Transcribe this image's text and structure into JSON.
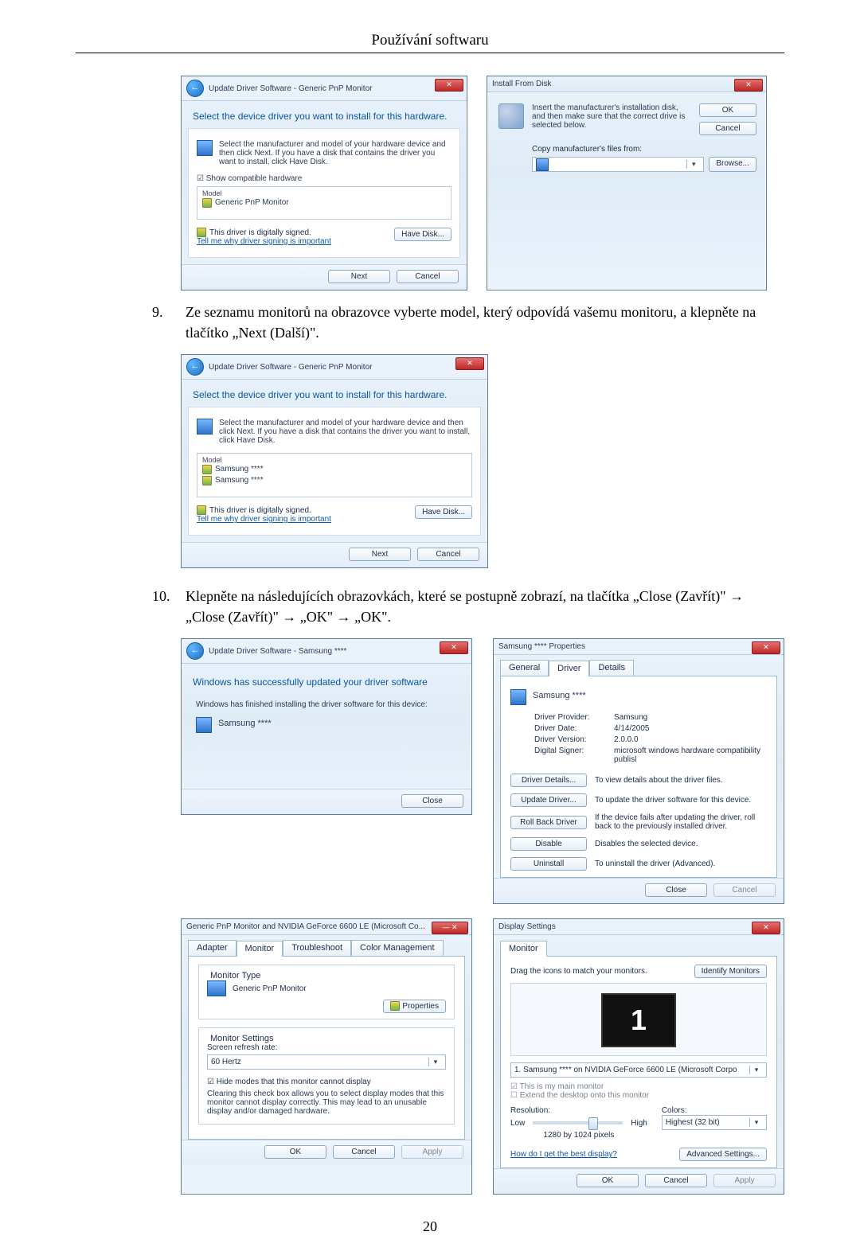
{
  "header": {
    "section_title": "Používání softwaru"
  },
  "page_number": "20",
  "steps": {
    "s9": {
      "num": "9.",
      "text": "Ze seznamu monitorů na obrazovce vyberte model, který odpovídá vašemu monitoru, a klepněte na tlačítko „Next (Další)\"."
    },
    "s10": {
      "num": "10.",
      "text": "Klepněte na následujících obrazovkách, které se postupně zobrazí, na tlačítka „Close (Zavřít)\" → „Close (Zavřít)\" → „OK\" → „OK\"."
    }
  },
  "winA": {
    "breadcrumb": "Update Driver Software - Generic PnP Monitor",
    "heading": "Select the device driver you want to install for this hardware.",
    "hint": "Select the manufacturer and model of your hardware device and then click Next. If you have a disk that contains the driver you want to install, click Have Disk.",
    "show_compat": "Show compatible hardware",
    "col_model": "Model",
    "item1": "Generic PnP Monitor",
    "signed": "This driver is digitally signed.",
    "tell_why": "Tell me why driver signing is important",
    "have_disk": "Have Disk...",
    "next": "Next",
    "cancel": "Cancel"
  },
  "winB": {
    "title": "Install From Disk",
    "msg": "Insert the manufacturer's installation disk, and then make sure that the correct drive is selected below.",
    "ok": "OK",
    "cancel": "Cancel",
    "copy_label": "Copy manufacturer's files from:",
    "browse": "Browse..."
  },
  "winC": {
    "breadcrumb": "Update Driver Software - Generic PnP Monitor",
    "heading": "Select the device driver you want to install for this hardware.",
    "hint": "Select the manufacturer and model of your hardware device and then click Next. If you have a disk that contains the driver you want to install, click Have Disk.",
    "col_model": "Model",
    "item1": "Samsung ****",
    "item2": "Samsung ****",
    "signed": "This driver is digitally signed.",
    "tell_why": "Tell me why driver signing is important",
    "have_disk": "Have Disk...",
    "next": "Next",
    "cancel": "Cancel"
  },
  "winD": {
    "breadcrumb": "Update Driver Software - Samsung ****",
    "line1": "Windows has successfully updated your driver software",
    "line2": "Windows has finished installing the driver software for this device:",
    "device": "Samsung ****",
    "close": "Close"
  },
  "winE": {
    "title": "Samsung **** Properties",
    "tab_general": "General",
    "tab_driver": "Driver",
    "tab_details": "Details",
    "heading": "Samsung ****",
    "lbl_provider": "Driver Provider:",
    "val_provider": "Samsung",
    "lbl_date": "Driver Date:",
    "val_date": "4/14/2005",
    "lbl_version": "Driver Version:",
    "val_version": "2.0.0.0",
    "lbl_signer": "Digital Signer:",
    "val_signer": "microsoft windows hardware compatibility publisl",
    "btn_details": "Driver Details...",
    "txt_details": "To view details about the driver files.",
    "btn_update": "Update Driver...",
    "txt_update": "To update the driver software for this device.",
    "btn_rollback": "Roll Back Driver",
    "txt_rollback": "If the device fails after updating the driver, roll back to the previously installed driver.",
    "btn_disable": "Disable",
    "txt_disable": "Disables the selected device.",
    "btn_uninstall": "Uninstall",
    "txt_uninstall": "To uninstall the driver (Advanced).",
    "close": "Close",
    "cancel": "Cancel"
  },
  "winF": {
    "title": "Generic PnP Monitor and NVIDIA GeForce 6600 LE (Microsoft Co...",
    "tab_adapter": "Adapter",
    "tab_monitor": "Monitor",
    "tab_trouble": "Troubleshoot",
    "tab_color": "Color Management",
    "grp_type": "Monitor Type",
    "type_value": "Generic PnP Monitor",
    "btn_props": "Properties",
    "grp_settings": "Monitor Settings",
    "lbl_refresh": "Screen refresh rate:",
    "val_refresh": "60 Hertz",
    "chk_hide": "Hide modes that this monitor cannot display",
    "hide_desc": "Clearing this check box allows you to select display modes that this monitor cannot display correctly. This may lead to an unusable display and/or damaged hardware.",
    "ok": "OK",
    "cancel": "Cancel",
    "apply": "Apply"
  },
  "winG": {
    "title": "Display Settings",
    "tab_monitor": "Monitor",
    "drag": "Drag the icons to match your monitors.",
    "identify": "Identify Monitors",
    "mon_num": "1",
    "dropdown": "1. Samsung **** on NVIDIA GeForce 6600 LE (Microsoft Corpo",
    "chk_main": "This is my main monitor",
    "chk_extend": "Extend the desktop onto this monitor",
    "lbl_res": "Resolution:",
    "lbl_low": "Low",
    "lbl_high": "High",
    "res_val": "1280 by 1024 pixels",
    "lbl_colors": "Colors:",
    "val_colors": "Highest (32 bit)",
    "link_best": "How do I get the best display?",
    "adv": "Advanced Settings...",
    "ok": "OK",
    "cancel": "Cancel",
    "apply": "Apply"
  }
}
